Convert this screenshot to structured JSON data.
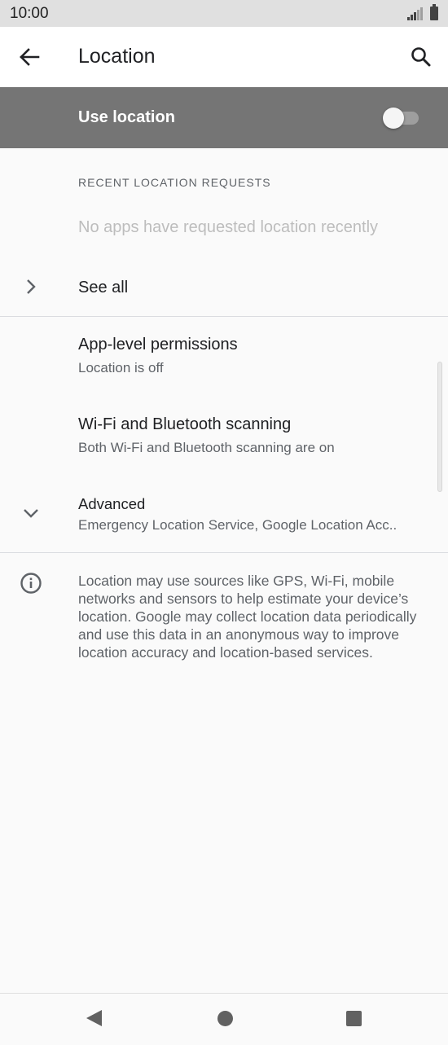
{
  "status_bar": {
    "time": "10:00",
    "icons": [
      "signal-icon",
      "battery-icon"
    ]
  },
  "app_bar": {
    "title": "Location",
    "back_icon": "arrow-back-icon",
    "search_icon": "search-icon"
  },
  "master_switch": {
    "label": "Use location",
    "state": "off"
  },
  "recent_requests": {
    "header": "RECENT LOCATION REQUESTS",
    "empty_text": "No apps have requested location recently",
    "see_all_label": "See all"
  },
  "settings": [
    {
      "title": "App-level permissions",
      "subtitle": "Location is off"
    },
    {
      "title": "Wi-Fi and Bluetooth scanning",
      "subtitle": "Both Wi-Fi and Bluetooth scanning are on"
    },
    {
      "title": "Advanced",
      "subtitle": "Emergency Location Service, Google Location Acc.."
    }
  ],
  "footer": {
    "text": "Location may use sources like GPS, Wi-Fi, mobile networks and sensors to help estimate your device’s location. Google may collect location data periodically and use this data in an anonymous way to improve location accuracy and location-based services."
  },
  "nav_bar": {
    "icons": [
      "nav-back-icon",
      "nav-home-icon",
      "nav-recents-icon"
    ]
  },
  "colors": {
    "master_bar": "#757575",
    "background": "#fafafa",
    "status_bar": "#e0e0e0"
  }
}
